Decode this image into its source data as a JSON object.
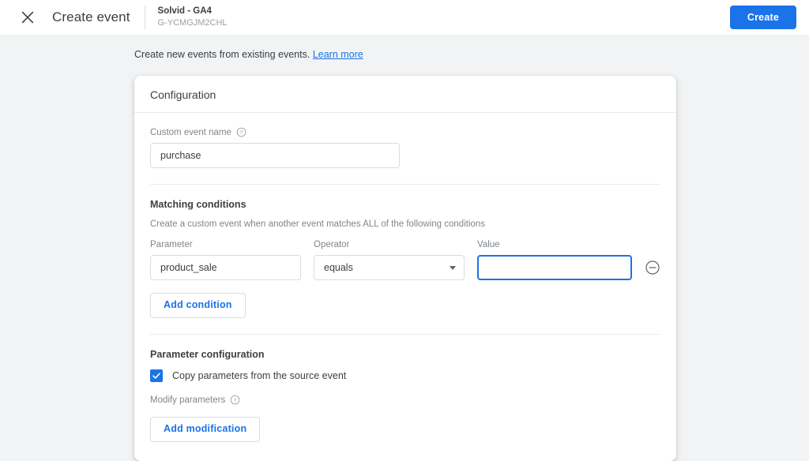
{
  "header": {
    "close_icon": "close-icon",
    "title": "Create event",
    "property_name": "Solvid - GA4",
    "property_id": "G-YCMGJM2CHL",
    "create_label": "Create",
    "accent_color": "#1a73e8"
  },
  "page": {
    "subtitle": "Create new events from existing events.",
    "learn_more": "Learn more"
  },
  "card": {
    "title": "Configuration",
    "custom_event": {
      "label": "Custom event name",
      "help_icon": "help-icon",
      "value": "purchase",
      "placeholder": ""
    },
    "matching": {
      "title": "Matching conditions",
      "description": "Create a custom event when another event matches ALL of the following conditions",
      "columns": {
        "parameter": "Parameter",
        "operator": "Operator",
        "value": "Value"
      },
      "conditions": [
        {
          "parameter": "product_sale",
          "operator": "equals",
          "value": "",
          "value_placeholder": "",
          "remove_icon": "remove-circle-icon"
        }
      ],
      "add_condition_label": "Add condition"
    },
    "parameters": {
      "title": "Parameter configuration",
      "copy_label": "Copy parameters from the source event",
      "copy_checked": true,
      "modify_label": "Modify parameters",
      "modify_help_icon": "help-icon",
      "add_modification_label": "Add modification"
    }
  }
}
